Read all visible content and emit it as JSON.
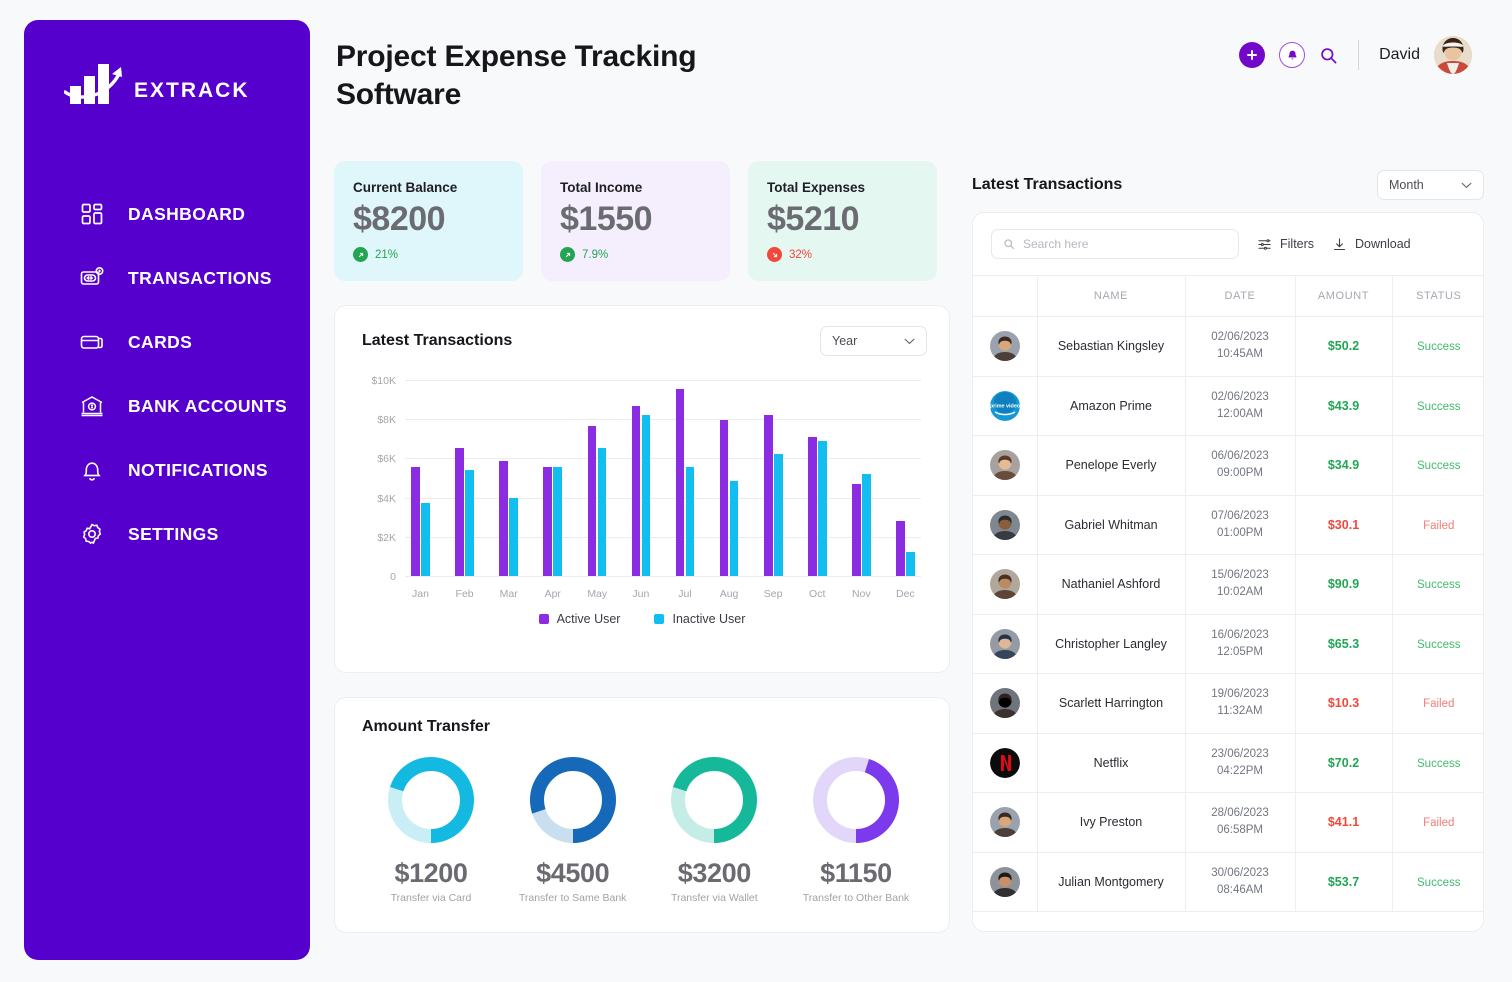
{
  "brand": {
    "name": "EXTRACK",
    "sidebar_color": "#5500CC"
  },
  "sidebar": {
    "items": [
      {
        "label": "DASHBOARD",
        "icon": "dashboard-icon"
      },
      {
        "label": "TRANSACTIONS",
        "icon": "transactions-icon"
      },
      {
        "label": "CARDS",
        "icon": "card-icon"
      },
      {
        "label": "BANK ACCOUNTS",
        "icon": "bank-icon"
      },
      {
        "label": "NOTIFICATIONS",
        "icon": "bell-icon"
      },
      {
        "label": "SETTINGS",
        "icon": "gear-icon"
      }
    ]
  },
  "header": {
    "title": "Project Expense Tracking Software",
    "user_name": "David",
    "icons": [
      "plus-icon",
      "bell-icon",
      "search-icon"
    ]
  },
  "stats": [
    {
      "label": "Current Balance",
      "value": "$8200",
      "delta": "21%",
      "direction": "up",
      "bg": "#DFF6FB",
      "delta_color": "#22A654",
      "dot_color": "#22A654"
    },
    {
      "label": "Total Income",
      "value": "$1550",
      "delta": "7.9%",
      "direction": "up",
      "bg": "#F4EEFD",
      "delta_color": "#22A654",
      "dot_color": "#22A654"
    },
    {
      "label": "Total Expenses",
      "value": "$5210",
      "delta": "32%",
      "direction": "down",
      "bg": "#E4F7F0",
      "delta_color": "#F4473B",
      "dot_color": "#F4473B"
    }
  ],
  "chart_panel": {
    "title": "Latest Transactions",
    "range_selected": "Year"
  },
  "chart_data": {
    "type": "bar",
    "title": "Latest Transactions",
    "xlabel": "",
    "ylabel": "",
    "ylim": [
      0,
      10000
    ],
    "yticks": [
      0,
      2000,
      4000,
      6000,
      8000,
      10000
    ],
    "ytick_labels": [
      "0",
      "$2K",
      "$4K",
      "$6K",
      "$8K",
      "$10K"
    ],
    "grid": true,
    "legend_position": "bottom",
    "categories": [
      "Jan",
      "Feb",
      "Mar",
      "Apr",
      "May",
      "Jun",
      "Jul",
      "Aug",
      "Sep",
      "Oct",
      "Nov",
      "Dec"
    ],
    "series": [
      {
        "name": "Active User",
        "color": "#8B2BE2",
        "values": [
          5550,
          6550,
          5850,
          5550,
          7650,
          8650,
          9550,
          7980,
          8200,
          7080,
          4700,
          2800
        ]
      },
      {
        "name": "Inactive User",
        "color": "#12BDEF",
        "values": [
          3750,
          5420,
          3970,
          5550,
          6550,
          8200,
          5550,
          4830,
          6250,
          6880,
          5180,
          1250
        ]
      }
    ]
  },
  "transfer_panel": {
    "title": "Amount Transfer",
    "items": [
      {
        "value": "$1200",
        "label": "Transfer via Card",
        "percent": 70,
        "color": "#14B9E2",
        "track": "#C9EEF6",
        "direction": "ccw"
      },
      {
        "value": "$4500",
        "label": "Transfer to Same Bank",
        "percent": 80,
        "color": "#1668B8",
        "track": "#C9DEEE",
        "direction": "ccw"
      },
      {
        "value": "$3200",
        "label": "Transfer via Wallet",
        "percent": 70,
        "color": "#15B99A",
        "track": "#C3EDE6",
        "direction": "ccw"
      },
      {
        "value": "$1150",
        "label": "Transfer to Other Bank",
        "percent": 45,
        "color": "#7C3AED",
        "track": "#E3D7F9",
        "direction": "ccw"
      }
    ]
  },
  "transactions": {
    "title": "Latest Transactions",
    "range_selected": "Month",
    "search_placeholder": "Search here",
    "filters_label": "Filters",
    "download_label": "Download",
    "columns": [
      "",
      "NAME",
      "DATE",
      "AMOUNT",
      "STATUS"
    ],
    "rows": [
      {
        "name": "Sebastian Kingsley",
        "date": "02/06/2023",
        "time": "10:45AM",
        "amount": "$50.2",
        "status": "Success",
        "avatar": "photo"
      },
      {
        "name": "Amazon Prime",
        "date": "02/06/2023",
        "time": "12:00AM",
        "amount": "$43.9",
        "status": "Success",
        "avatar": "prime-video-logo"
      },
      {
        "name": "Penelope Everly",
        "date": "06/06/2023",
        "time": "09:00PM",
        "amount": "$34.9",
        "status": "Success",
        "avatar": "photo"
      },
      {
        "name": "Gabriel Whitman",
        "date": "07/06/2023",
        "time": "01:00PM",
        "amount": "$30.1",
        "status": "Failed",
        "avatar": "photo"
      },
      {
        "name": "Nathaniel Ashford",
        "date": "15/06/2023",
        "time": "10:02AM",
        "amount": "$90.9",
        "status": "Success",
        "avatar": "photo"
      },
      {
        "name": "Christopher Langley",
        "date": "16/06/2023",
        "time": "12:05PM",
        "amount": "$65.3",
        "status": "Success",
        "avatar": "photo"
      },
      {
        "name": "Scarlett Harrington",
        "date": "19/06/2023",
        "time": "11:32AM",
        "amount": "$10.3",
        "status": "Failed",
        "avatar": "photo"
      },
      {
        "name": "Netflix",
        "date": "23/06/2023",
        "time": "04:22PM",
        "amount": "$70.2",
        "status": "Success",
        "avatar": "netflix-logo"
      },
      {
        "name": "Ivy Preston",
        "date": "28/06/2023",
        "time": "06:58PM",
        "amount": "$41.1",
        "status": "Failed",
        "avatar": "photo"
      },
      {
        "name": "Julian Montgomery",
        "date": "30/06/2023",
        "time": "08:46AM",
        "amount": "$53.7",
        "status": "Success",
        "avatar": "photo"
      }
    ]
  }
}
